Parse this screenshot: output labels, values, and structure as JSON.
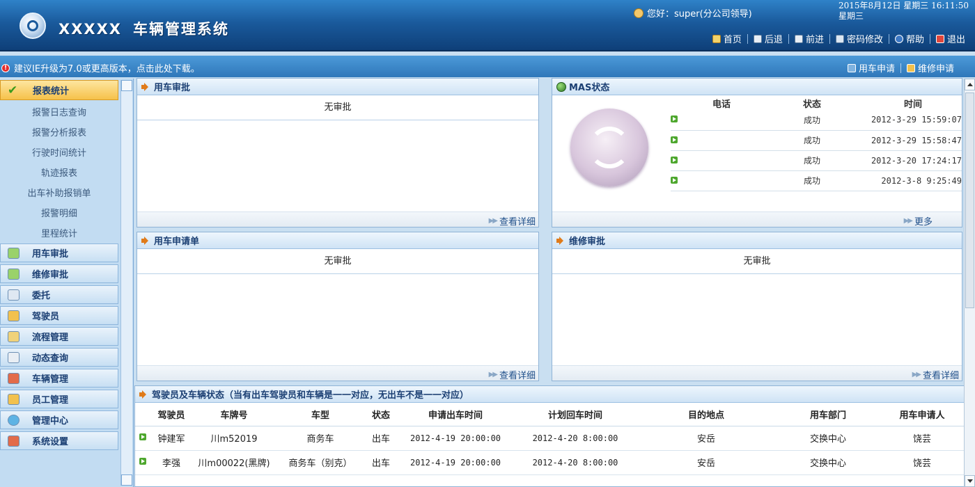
{
  "header": {
    "brand": "XXXXX",
    "system_name": "车辆管理系统",
    "greeting": "您好：super(分公司领导)",
    "date_line1": "2015年8月12日  星期三  16:11:50",
    "date_line2": "星期三",
    "nav": {
      "home": "首页",
      "back": "后退",
      "forward": "前进",
      "password": "密码修改",
      "help": "帮助",
      "logout": "退出"
    }
  },
  "notice": {
    "text": "建议IE升级为7.0或更高版本，点击此处下载。",
    "quick_car_apply": "用车申请",
    "quick_repair_apply": "维修申请"
  },
  "sidebar": {
    "active": "报表统计",
    "sub_items": [
      "报警日志查询",
      "报警分析报表",
      "行驶时间统计",
      "轨迹报表",
      "出车补助报销单",
      "报警明细",
      "里程统计"
    ],
    "groups": [
      "用车审批",
      "维修审批",
      "委托",
      "驾驶员",
      "流程管理",
      "动态查询",
      "车辆管理",
      "员工管理",
      "管理中心",
      "系统设置"
    ]
  },
  "panels": {
    "car_approval": {
      "title": "用车审批",
      "empty": "无审批",
      "more": "查看详细"
    },
    "mas": {
      "title": "MAS状态",
      "columns": [
        "电话",
        "状态",
        "时间"
      ],
      "rows": [
        {
          "phone": "",
          "status": "成功",
          "time": "2012-3-29 15:59:07"
        },
        {
          "phone": "",
          "status": "成功",
          "time": "2012-3-29 15:58:47"
        },
        {
          "phone": "",
          "status": "成功",
          "time": "2012-3-20 17:24:17"
        },
        {
          "phone": "",
          "status": "成功",
          "time": "2012-3-8 9:25:49"
        }
      ],
      "more": "更多"
    },
    "car_request": {
      "title": "用车申请单",
      "empty": "无审批",
      "more": "查看详细"
    },
    "repair_approval": {
      "title": "维修审批",
      "empty": "无审批",
      "more": "查看详细"
    }
  },
  "drivers": {
    "title": "驾驶员及车辆状态（当有出车驾驶员和车辆是一一对应，无出车不是一一对应）",
    "columns": [
      "驾驶员",
      "车牌号",
      "车型",
      "状态",
      "申请出车时间",
      "计划回车时间",
      "目的地点",
      "用车部门",
      "用车申请人"
    ],
    "rows": [
      [
        "钟建军",
        "川m52019",
        "商务车",
        "出车",
        "2012-4-19 20:00:00",
        "2012-4-20 8:00:00",
        "安岳",
        "交换中心",
        "饶芸"
      ],
      [
        "李强",
        "川m00022(黑牌)",
        "商务车（别克）",
        "出车",
        "2012-4-19 20:00:00",
        "2012-4-20 8:00:00",
        "安岳",
        "交换中心",
        "饶芸"
      ]
    ]
  },
  "colors": {
    "header_blue": "#1a5a9c",
    "active_orange": "#f6c14a",
    "link_blue": "#1f4f8a"
  }
}
